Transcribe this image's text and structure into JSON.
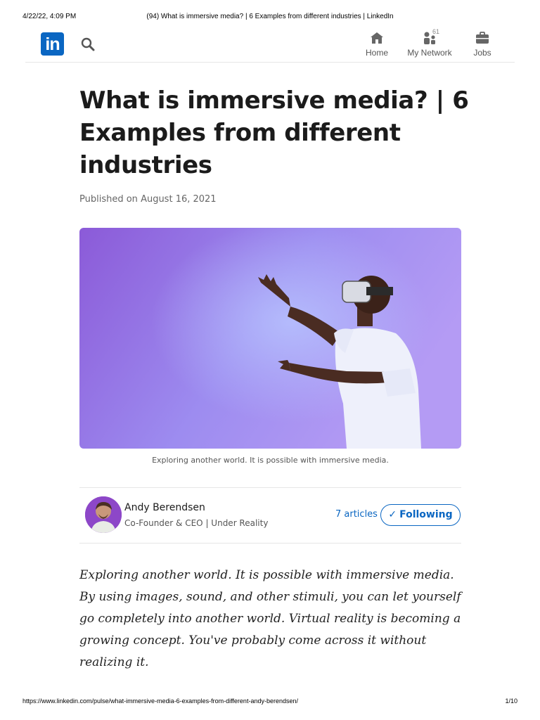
{
  "print_header": {
    "datetime": "4/22/22, 4:09 PM",
    "page_title": "(94) What is immersive media? | 6 Examples from different industries | LinkedIn"
  },
  "nav": {
    "logo_text": "in",
    "items": [
      {
        "label": "Home",
        "icon": "home-icon"
      },
      {
        "label": "My Network",
        "icon": "network-icon",
        "badge": "61"
      },
      {
        "label": "Jobs",
        "icon": "briefcase-icon"
      }
    ]
  },
  "article": {
    "title": "What is immersive media? | 6 Examples from different industries",
    "published_prefix": "Published on",
    "published_date": "August 16, 2021",
    "hero_caption": "Exploring another world. It is possible with immersive media.",
    "body_paragraph": "Exploring another world. It is possible with immersive media. By using images, sound, and other stimuli, you can let yourself go completely into another world. Virtual reality is becoming a growing concept. You've probably come across it without realizing it."
  },
  "author": {
    "name": "Andy Berendsen",
    "headline": "Co-Founder & CEO | Under Reality",
    "articles_count": "7 articles",
    "follow_label": "Following"
  },
  "print_footer": {
    "url": "https://www.linkedin.com/pulse/what-immersive-media-6-examples-from-different-andy-berendsen/",
    "page": "1/10"
  },
  "colors": {
    "brand": "#0a66c2",
    "hero_gradient_start": "#8a5ad6",
    "hero_gradient_end": "#a8a6f4"
  }
}
